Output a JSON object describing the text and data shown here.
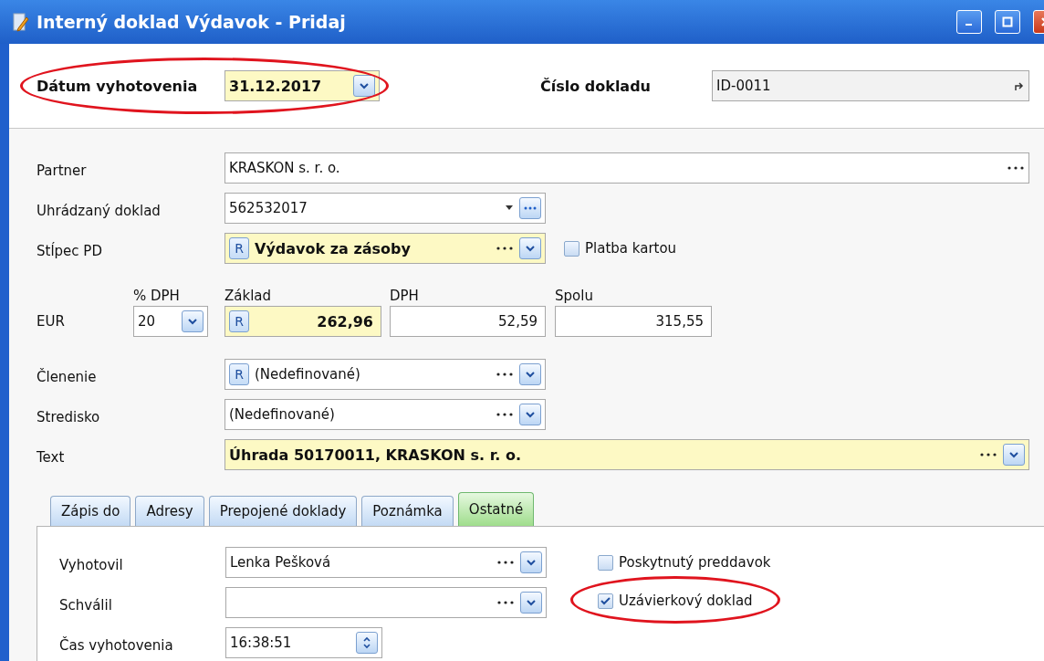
{
  "window": {
    "title": "Interný doklad Výdavok - Pridaj"
  },
  "header": {
    "date": {
      "label": "Dátum vyhotovenia",
      "value": "31.12.2017",
      "kind": "date",
      "emphasis": true,
      "highlighted": true
    },
    "number": {
      "label": "Číslo dokladu",
      "value": "ID-0011",
      "kind": "link"
    }
  },
  "fields": [
    {
      "label": "Partner",
      "value": "KRASKON s. r. o.",
      "kind": "more",
      "wide": true
    },
    {
      "label": "Uhrádzaný doklad",
      "value": "562532017",
      "kind": "lookup"
    },
    {
      "label": "Stĺpec PD",
      "value": "Výdavok za zásoby",
      "badge": "R",
      "emphasis": true,
      "kind": "combo",
      "checkbox": {
        "label": "Platba kartou",
        "checked": false
      }
    }
  ],
  "amounts": {
    "currency": "EUR",
    "columns": [
      {
        "label": "% DPH",
        "value": "20",
        "kind": "dropdown"
      },
      {
        "label": "Základ",
        "value": "262,96",
        "badge": "R",
        "emphasis": true,
        "kind": "amount"
      },
      {
        "label": "DPH",
        "value": "52,59",
        "kind": "amount"
      },
      {
        "label": "Spolu",
        "value": "315,55",
        "kind": "amount"
      }
    ]
  },
  "fields_2": [
    {
      "label": "Členenie",
      "value": "(Nedefinované)",
      "badge": "R",
      "kind": "combo"
    },
    {
      "label": "Stredisko",
      "value": "(Nedefinované)",
      "kind": "combo"
    },
    {
      "label": "Text",
      "value": "Úhrada 50170011, KRASKON s. r. o.",
      "emphasis": true,
      "kind": "combo",
      "wide": true
    }
  ],
  "tabs": [
    {
      "label": "Zápis do",
      "selected": false
    },
    {
      "label": "Adresy",
      "selected": false
    },
    {
      "label": "Prepojené doklady",
      "selected": false
    },
    {
      "label": "Poznámka",
      "selected": false
    },
    {
      "label": "Ostatné",
      "selected": true
    }
  ],
  "tab_panel": {
    "fields": [
      {
        "label": "Vyhotovil",
        "value": "Lenka Pešková",
        "kind": "combo"
      },
      {
        "label": "Schválil",
        "kind": "combo"
      },
      {
        "label": "Čas vyhotovenia",
        "value": "16:38:51",
        "kind": "spin",
        "short": true
      }
    ],
    "checkboxes": [
      {
        "label": "Poskytnutý preddavok",
        "checked": false,
        "highlighted": false
      },
      {
        "label": "Uzávierkový doklad",
        "checked": true,
        "highlighted": true
      }
    ]
  }
}
